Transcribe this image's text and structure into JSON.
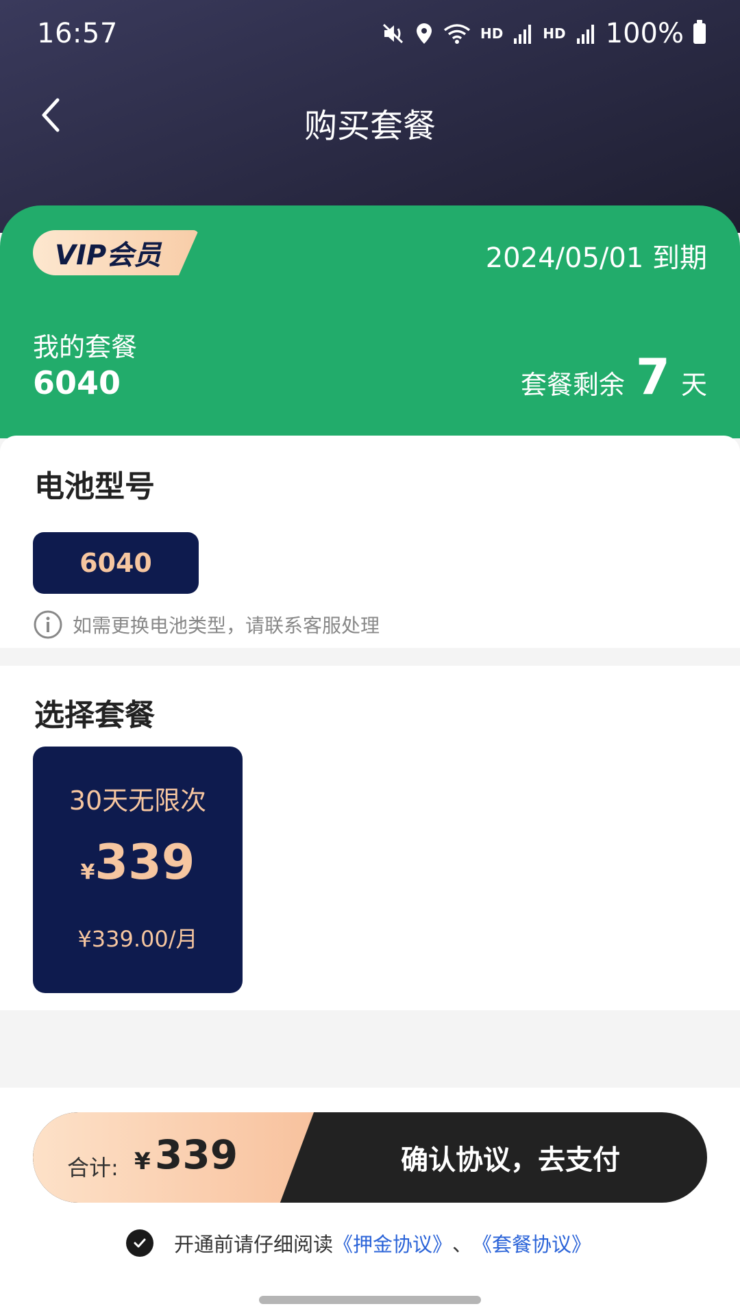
{
  "status_bar": {
    "time": "16:57",
    "hd1": "HD",
    "hd2": "HD",
    "battery": "100%",
    "icons": [
      "mute-icon",
      "location-icon",
      "wifi-icon",
      "signal-icon",
      "signal-icon",
      "battery-icon"
    ]
  },
  "header": {
    "title": "购买套餐",
    "back_icon": "chevron-left-icon"
  },
  "vip_card": {
    "badge": "VIP会员",
    "expiry": "2024/05/01 到期",
    "my_plan_label": "我的套餐",
    "my_plan_value": "6040",
    "remaining_label": "套餐剩余",
    "remaining_days": "7",
    "remaining_unit": "天",
    "color": "#22ac6b"
  },
  "battery_section": {
    "title": "电池型号",
    "selected_model": "6040",
    "hint": "如需更换电池类型，请联系客服处理",
    "hint_icon": "info-icon"
  },
  "plan_section": {
    "title": "选择套餐",
    "plans": [
      {
        "name": "30天无限次",
        "currency": "¥",
        "price": "339",
        "monthly": "¥339.00/月"
      }
    ]
  },
  "checkout": {
    "total_label": "合计:",
    "currency": "¥",
    "total": "339",
    "pay_button": "确认协议，去支付"
  },
  "agreement": {
    "prefix": "开通前请仔细阅读",
    "link1": "《押金协议》",
    "separator": "、",
    "link2": "《套餐协议》",
    "checked": true
  },
  "colors": {
    "accent_green": "#22ac6b",
    "navy": "#0e1b4e",
    "peach": "#f6c6a0",
    "link_blue": "#2a63d8"
  }
}
